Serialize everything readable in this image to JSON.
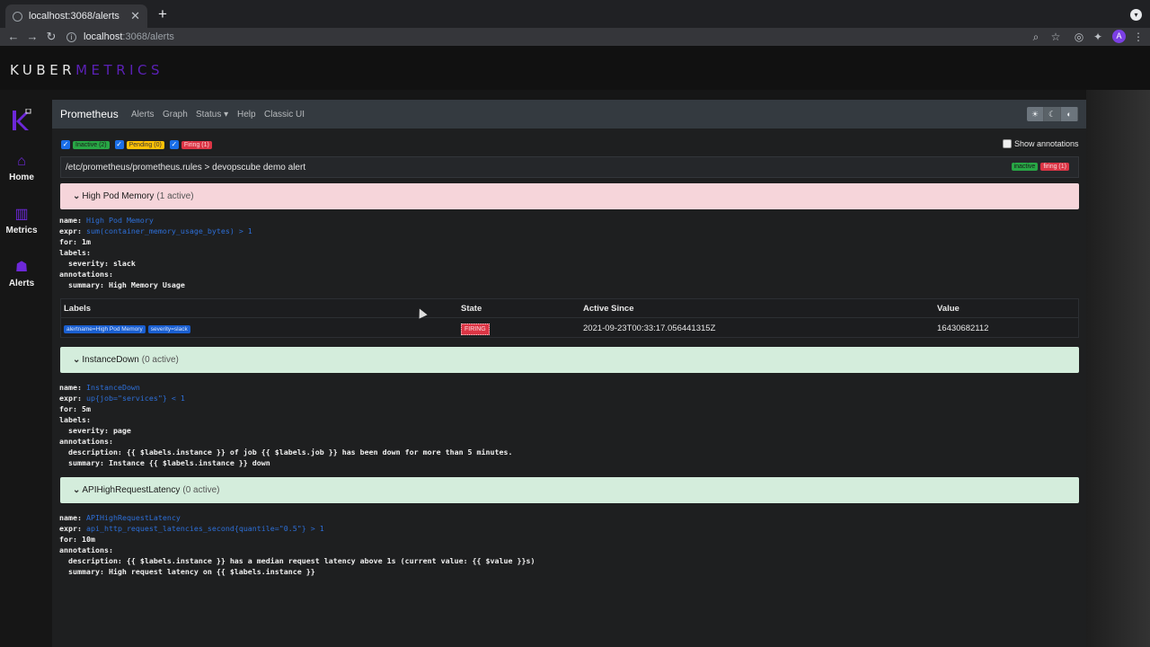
{
  "browser": {
    "tab_title": "localhost:3068/alerts",
    "url_host": "localhost",
    "url_rest": ":3068/alerts",
    "profile_initial": "A"
  },
  "brand": {
    "part1": "KUBER",
    "part2": "METRICS"
  },
  "sidebar": {
    "items": [
      {
        "label": "Home",
        "icon": "home-icon"
      },
      {
        "label": "Metrics",
        "icon": "metrics-icon"
      },
      {
        "label": "Alerts",
        "icon": "alerts-icon"
      }
    ]
  },
  "prometheus_nav": {
    "brand": "Prometheus",
    "links": [
      "Alerts",
      "Graph",
      "Status",
      "Help",
      "Classic UI"
    ]
  },
  "filters": {
    "inactive": "Inactive (2)",
    "pending": "Pending (0)",
    "firing": "Firing (1)",
    "show_annotations": "Show annotations"
  },
  "rule_file": {
    "path": "/etc/prometheus/prometheus.rules > devopscube demo alert",
    "badge_inactive": "inactive",
    "badge_firing": "firing (1)"
  },
  "alerts": [
    {
      "name": "High Pod Memory",
      "count": "(1 active)",
      "state": "firing",
      "yaml": {
        "name_value": "High Pod Memory",
        "expr_value": "sum(container_memory_usage_bytes) > 1",
        "for": "for: 1m",
        "labels": "labels:",
        "labels_line": "  severity: slack",
        "annotations": "annotations:",
        "ann_line1": "  summary: High Memory Usage"
      }
    },
    {
      "name": "InstanceDown",
      "count": "(0 active)",
      "state": "inactive",
      "yaml": {
        "name_value": "InstanceDown",
        "expr_value": "up{job=\"services\"} < 1",
        "for": "for: 5m",
        "labels": "labels:",
        "labels_line": "  severity: page",
        "annotations": "annotations:",
        "ann_line1": "  description: {{ $labels.instance }} of job {{ $labels.job }} has been down for more than 5 minutes.",
        "ann_line2": "  summary: Instance {{ $labels.instance }} down"
      }
    },
    {
      "name": "APIHighRequestLatency",
      "count": "(0 active)",
      "state": "inactive",
      "yaml": {
        "name_value": "APIHighRequestLatency",
        "expr_value": "api_http_request_latencies_second{quantile=\"0.5\"} > 1",
        "for": "for: 10m",
        "annotations": "annotations:",
        "ann_line1": "  description: {{ $labels.instance }} has a median request latency above 1s (current value: {{ $value }}s)",
        "ann_line2": "  summary: High request latency on {{ $labels.instance }}"
      }
    }
  ],
  "active_table": {
    "headers": [
      "Labels",
      "State",
      "Active Since",
      "Value"
    ],
    "row": {
      "labels": [
        "alertname=High Pod Memory",
        "severity=slack"
      ],
      "state": "FIRING",
      "active_since": "2021-09-23T00:33:17.056441315Z",
      "value": "16430682112"
    }
  },
  "yaml_keys": {
    "name": "name: ",
    "expr": "expr: "
  },
  "colors": {
    "brand_purple": "#5b21b6",
    "firing_bg": "#f6d5da",
    "ok_bg": "#d4eddc",
    "link_blue": "#2d6fd8"
  }
}
